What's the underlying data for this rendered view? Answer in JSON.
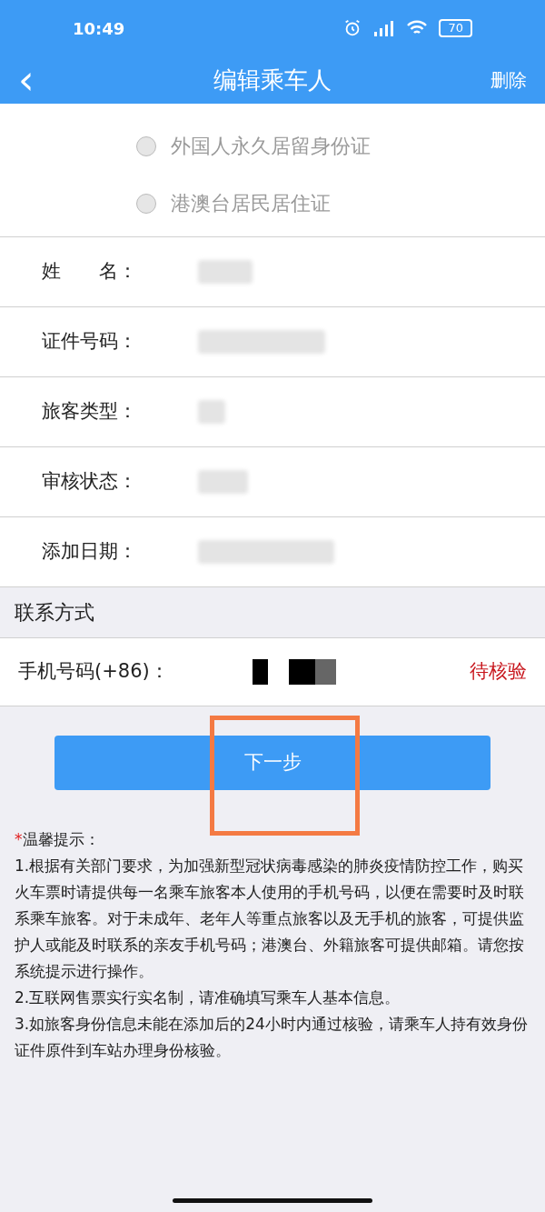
{
  "status_bar": {
    "time": "10:49",
    "battery": "70"
  },
  "header": {
    "back": "‹",
    "title": "编辑乘车人",
    "action": "删除"
  },
  "id_types": [
    {
      "label": "外国人永久居留身份证",
      "selected": false
    },
    {
      "label": "港澳台居民居住证",
      "selected": false
    }
  ],
  "fields": [
    {
      "label": "姓　　名："
    },
    {
      "label": "证件号码："
    },
    {
      "label": "旅客类型："
    },
    {
      "label": "审核状态："
    },
    {
      "label": "添加日期："
    }
  ],
  "contact": {
    "heading": "联系方式",
    "label": "手机号码(+86)：",
    "status": "待核验"
  },
  "next_button": "下一步",
  "notice": {
    "mark": "*",
    "title": "温馨提示：",
    "items": [
      "1.根据有关部门要求，为加强新型冠状病毒感染的肺炎疫情防控工作，购买火车票时请提供每一名乘车旅客本人使用的手机号码，以便在需要时及时联系乘车旅客。对于未成年、老年人等重点旅客以及无手机的旅客，可提供监护人或能及时联系的亲友手机号码；港澳台、外籍旅客可提供邮箱。请您按系统提示进行操作。",
      "2.互联网售票实行实名制，请准确填写乘车人基本信息。",
      "3.如旅客身份信息未能在添加后的24小时内通过核验，请乘车人持有效身份证件原件到车站办理身份核验。"
    ]
  }
}
